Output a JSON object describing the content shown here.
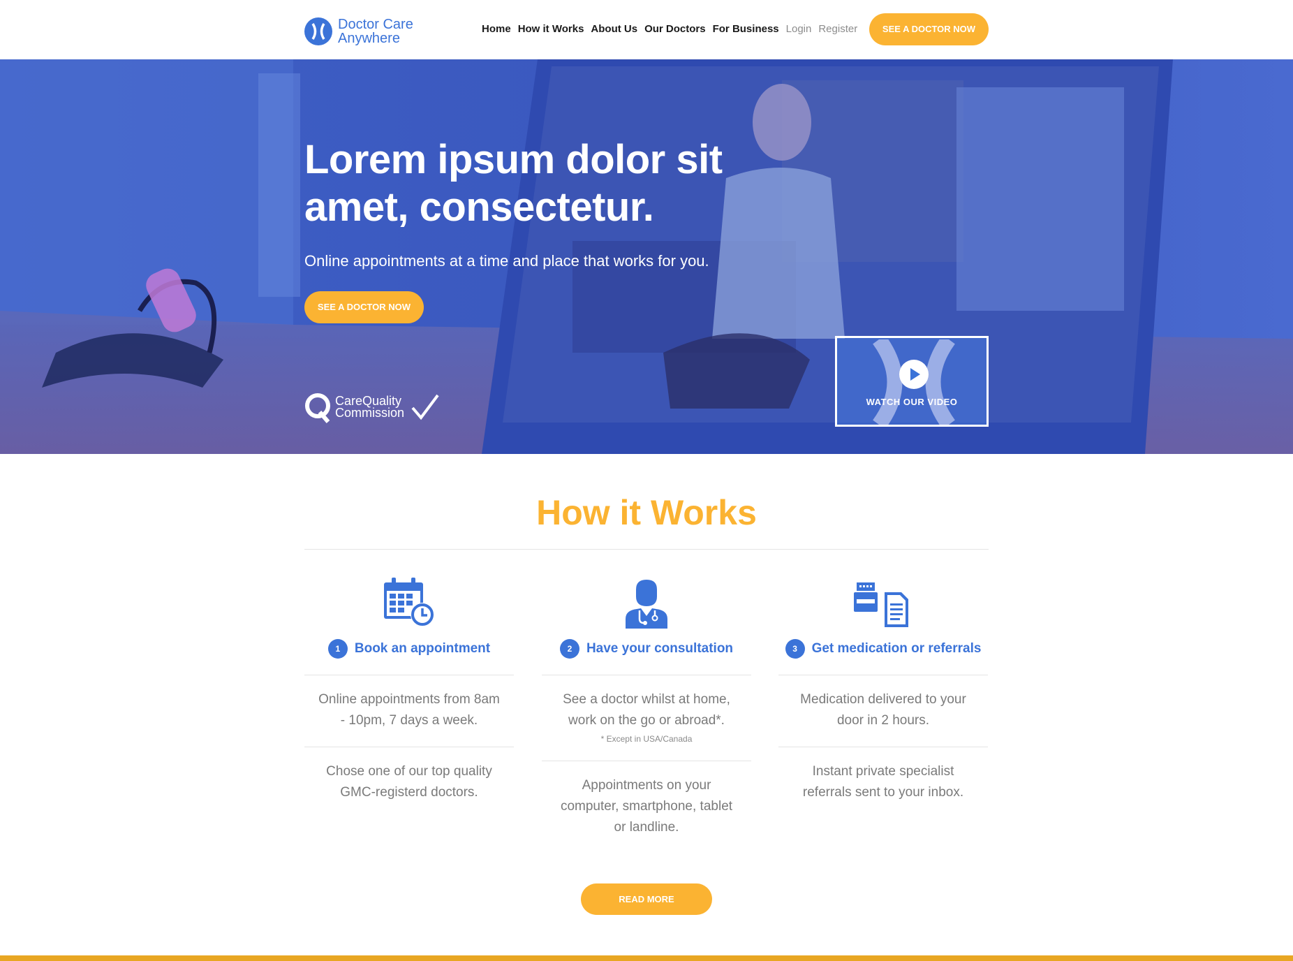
{
  "brand": {
    "name_line1": "Doctor Care",
    "name_line2": "Anywhere",
    "color_primary": "#3b73d8",
    "color_accent": "#fbb332"
  },
  "nav": {
    "items": [
      {
        "label": "Home"
      },
      {
        "label": "How it Works"
      },
      {
        "label": "About Us"
      },
      {
        "label": "Our Doctors"
      },
      {
        "label": "For Business"
      }
    ],
    "login": "Login",
    "register": "Register",
    "cta": "SEE A DOCTOR NOW"
  },
  "hero": {
    "title": "Lorem ipsum dolor sit amet, consectetur.",
    "subtitle": "Online appointments at a time and place that works for you.",
    "cta": "SEE A DOCTOR NOW",
    "cqc_line1": "CareQuality",
    "cqc_line2": "Commission",
    "video_label": "WATCH OUR VIDEO"
  },
  "how": {
    "title": "How it Works",
    "columns": [
      {
        "icon": "calendar-clock-icon",
        "num": "1",
        "heading": "Book an appointment",
        "text1": "Online appointments from 8am - 10pm, 7 days a week.",
        "note": "",
        "text2": "Chose one of our top quality GMC-registerd doctors."
      },
      {
        "icon": "doctor-icon",
        "num": "2",
        "heading": "Have your consultation",
        "text1": "See a doctor whilst at home, work on the go or abroad*.",
        "note": "* Except in USA/Canada",
        "text2": "Appointments on your computer, smartphone, tablet or landline."
      },
      {
        "icon": "printer-document-icon",
        "num": "3",
        "heading": "Get medication or referrals",
        "text1": "Medication delivered to your door in 2 hours.",
        "note": "",
        "text2": "Instant private specialist referrals sent to your inbox."
      }
    ],
    "read_more": "READ MORE"
  }
}
